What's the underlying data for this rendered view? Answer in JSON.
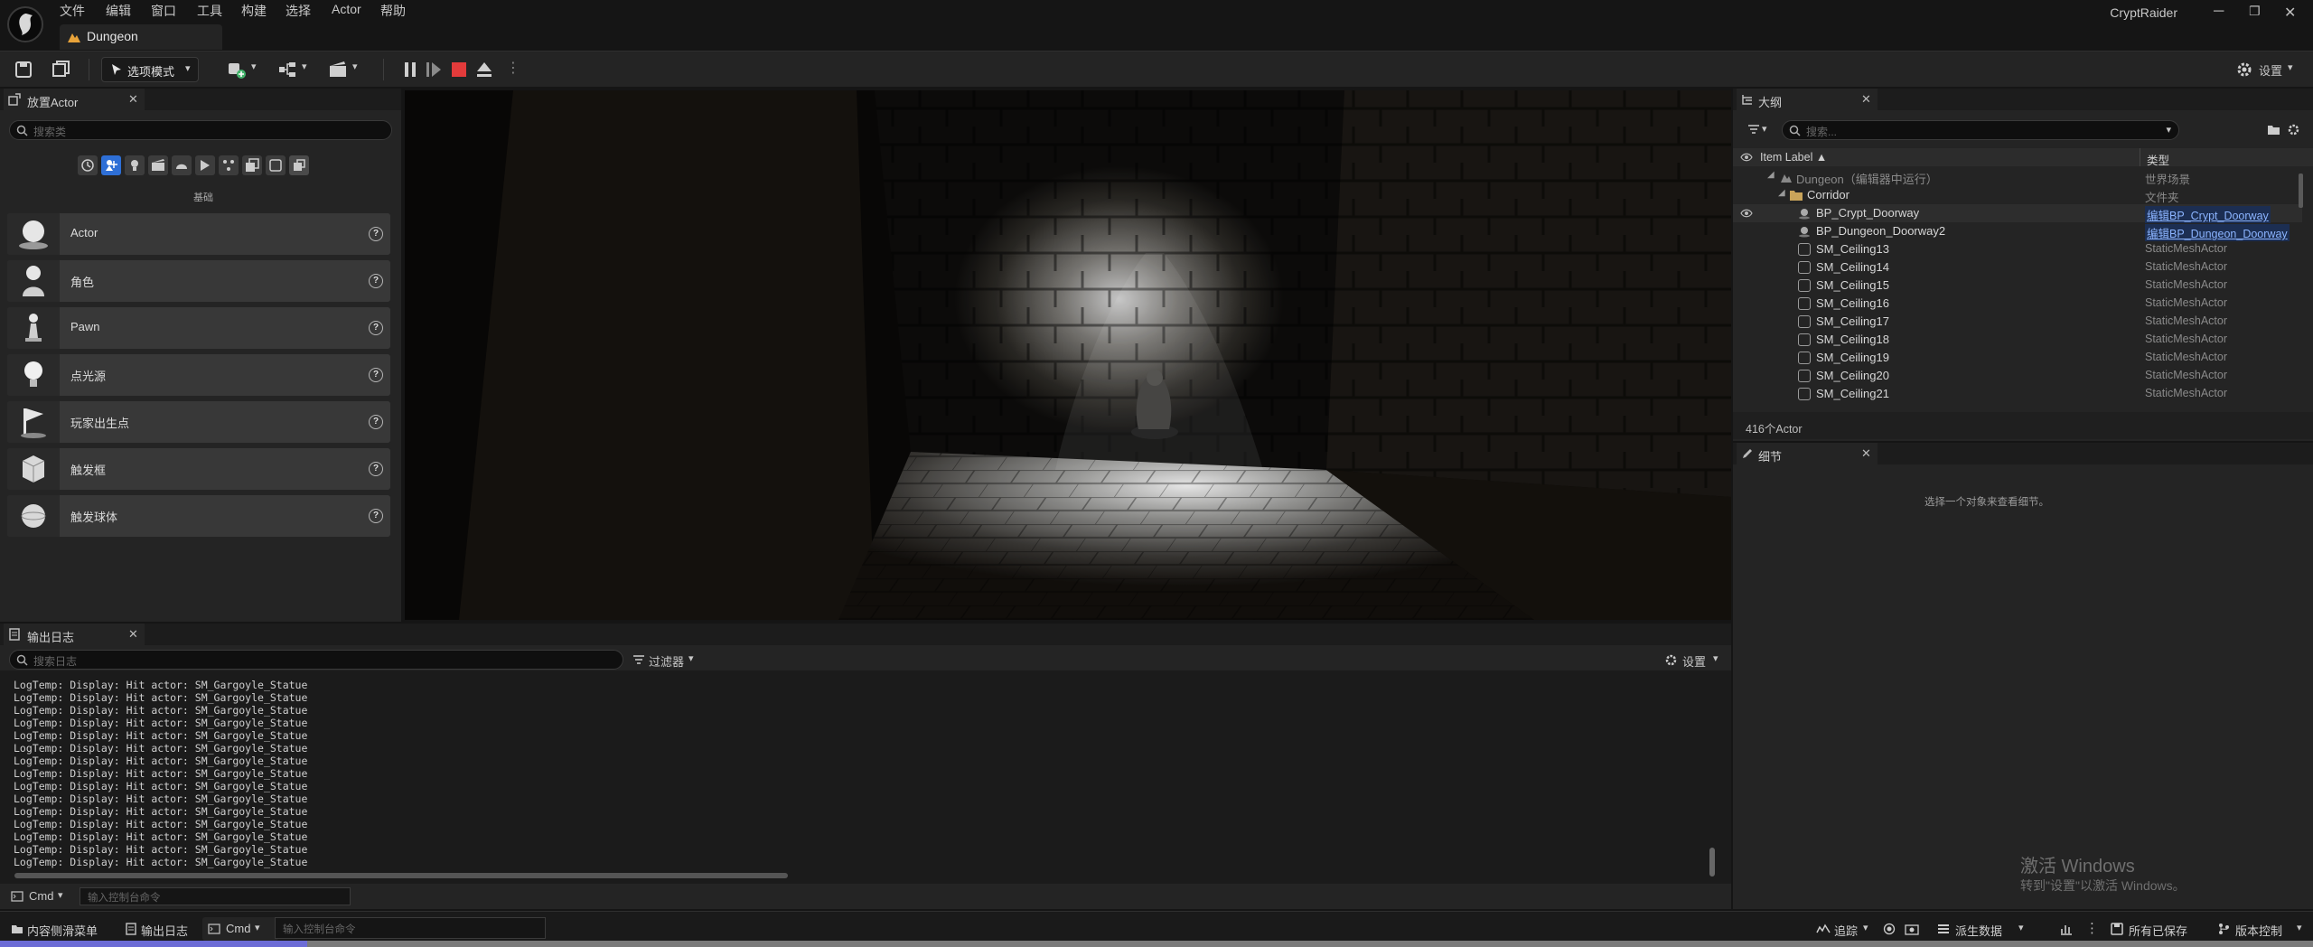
{
  "menu": [
    "文件",
    "编辑",
    "窗口",
    "工具",
    "构建",
    "选择",
    "Actor",
    "帮助"
  ],
  "document_tab": "Dungeon",
  "app_name": "CryptRaider",
  "toolbar": {
    "mode_label": "选项模式",
    "settings_label": "设置"
  },
  "place_actors": {
    "tab_title": "放置Actor",
    "search_placeholder": "搜索类",
    "category_title": "基础",
    "items": [
      "Actor",
      "角色",
      "Pawn",
      "点光源",
      "玩家出生点",
      "触发框",
      "触发球体"
    ]
  },
  "outliner": {
    "tab_title": "大纲",
    "search_placeholder": "搜索...",
    "col_label": "Item Label ▲",
    "col_type": "类型",
    "rows": [
      {
        "name": "Dungeon（编辑器中运行）",
        "type": "世界场景"
      },
      {
        "name": "Corridor",
        "type": "文件夹"
      },
      {
        "name": "BP_Crypt_Doorway",
        "type": "编辑BP_Crypt_Doorway"
      },
      {
        "name": "BP_Dungeon_Doorway2",
        "type": "编辑BP_Dungeon_Doorway"
      },
      {
        "name": "SM_Ceiling13",
        "type": "StaticMeshActor"
      },
      {
        "name": "SM_Ceiling14",
        "type": "StaticMeshActor"
      },
      {
        "name": "SM_Ceiling15",
        "type": "StaticMeshActor"
      },
      {
        "name": "SM_Ceiling16",
        "type": "StaticMeshActor"
      },
      {
        "name": "SM_Ceiling17",
        "type": "StaticMeshActor"
      },
      {
        "name": "SM_Ceiling18",
        "type": "StaticMeshActor"
      },
      {
        "name": "SM_Ceiling19",
        "type": "StaticMeshActor"
      },
      {
        "name": "SM_Ceiling20",
        "type": "StaticMeshActor"
      },
      {
        "name": "SM_Ceiling21",
        "type": "StaticMeshActor"
      }
    ],
    "actor_count": "416个Actor"
  },
  "details": {
    "tab_title": "细节",
    "empty_text": "选择一个对象来查看细节。"
  },
  "output_log": {
    "tab_title": "输出日志",
    "search_placeholder": "搜索日志",
    "filter_label": "过滤器",
    "settings_label": "设置",
    "lines": [
      "LogTemp: Display: Hit actor: SM_Gargoyle_Statue",
      "LogTemp: Display: Hit actor: SM_Gargoyle_Statue",
      "LogTemp: Display: Hit actor: SM_Gargoyle_Statue",
      "LogTemp: Display: Hit actor: SM_Gargoyle_Statue",
      "LogTemp: Display: Hit actor: SM_Gargoyle_Statue",
      "LogTemp: Display: Hit actor: SM_Gargoyle_Statue",
      "LogTemp: Display: Hit actor: SM_Gargoyle_Statue",
      "LogTemp: Display: Hit actor: SM_Gargoyle_Statue",
      "LogTemp: Display: Hit actor: SM_Gargoyle_Statue",
      "LogTemp: Display: Hit actor: SM_Gargoyle_Statue",
      "LogTemp: Display: Hit actor: SM_Gargoyle_Statue",
      "LogTemp: Display: Hit actor: SM_Gargoyle_Statue",
      "LogTemp: Display: Hit actor: SM_Gargoyle_Statue",
      "LogTemp: Display: Hit actor: SM_Gargoyle_Statue",
      "LogTemp: Display: Hit actor: SM_Gargoyle_Statue"
    ],
    "cmd_label": "Cmd",
    "cmd_placeholder": "输入控制台命令"
  },
  "statusbar": {
    "content_drawer": "内容侧滑菜单",
    "output_log": "输出日志",
    "cmd_label": "Cmd",
    "cmd_placeholder": "输入控制台命令",
    "trace": "追踪",
    "derived_data": "派生数据",
    "all_saved": "所有已保存",
    "source_control": "版本控制"
  },
  "watermark": {
    "line1": "激活 Windows",
    "line2": "转到\"设置\"以激活 Windows。"
  }
}
